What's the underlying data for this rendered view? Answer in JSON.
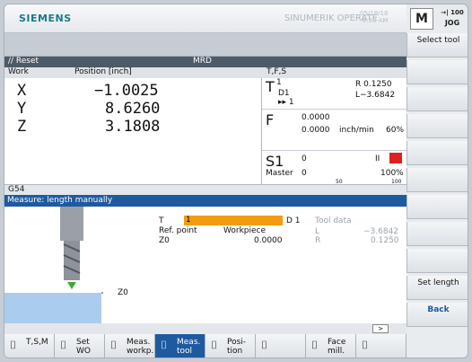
{
  "header": {
    "brand": "SIEMENS",
    "product": "SINUMERIK OPERATE",
    "date_line1": "05/18/18",
    "date_line2": "8:30 AM",
    "mode_button": "M",
    "mode_arrow": "→| 100",
    "mode": "JOG"
  },
  "status": {
    "reset": "// Reset",
    "program": "MRD"
  },
  "work_header": {
    "col1": "Work",
    "col2": "Position [inch]",
    "tfs": "T,F,S"
  },
  "axes": [
    {
      "name": "X",
      "value": "−1.0025"
    },
    {
      "name": "Y",
      "value": "8.6260"
    },
    {
      "name": "Z",
      "value": "3.1808"
    }
  ],
  "tfs": {
    "t_label": "T",
    "t_num": "1",
    "d_label": "D1",
    "sub": "▸▸ 1",
    "r": "R 0.1250",
    "l": "L−3.6842",
    "f_label": "F",
    "f1": "0.0000",
    "f2": "0.0000",
    "f_unit": "inch/min",
    "f_pct": "60%",
    "s_label": "S1",
    "s_sub": "Master",
    "s1": "0",
    "s2": "0",
    "s_state": "II",
    "s_pct": "100%",
    "s_scale_mid": "50",
    "s_scale_max": "100"
  },
  "frame": "G54",
  "measure": {
    "title": "Measure: length manually",
    "t_label": "T",
    "t_value": "1",
    "d_label": "D 1",
    "ref_label": "Ref. point",
    "ref_value": "Workpiece",
    "z0_label": "Z0",
    "z0_value": "0.0000",
    "tooldata": "Tool data",
    "l_label": "L",
    "l_value": "−3.6842",
    "r_label": "R",
    "r_value": "0.1250",
    "z0_marker": "Z0"
  },
  "softkeys": [
    "Select tool",
    "",
    "",
    "",
    "",
    "",
    "",
    "",
    "",
    "Set length",
    "Back"
  ],
  "hkeys": [
    {
      "label": "T,S,M"
    },
    {
      "label": "Set WO"
    },
    {
      "label": "Meas. workp."
    },
    {
      "label": "Meas. tool",
      "active": true
    },
    {
      "label": "Posi- tion"
    },
    {
      "label": ""
    },
    {
      "label": "Face mill."
    },
    {
      "label": ""
    }
  ],
  "colors": {
    "accent": "#1e5aa0",
    "orange": "#f39c12",
    "red": "#e02020"
  }
}
